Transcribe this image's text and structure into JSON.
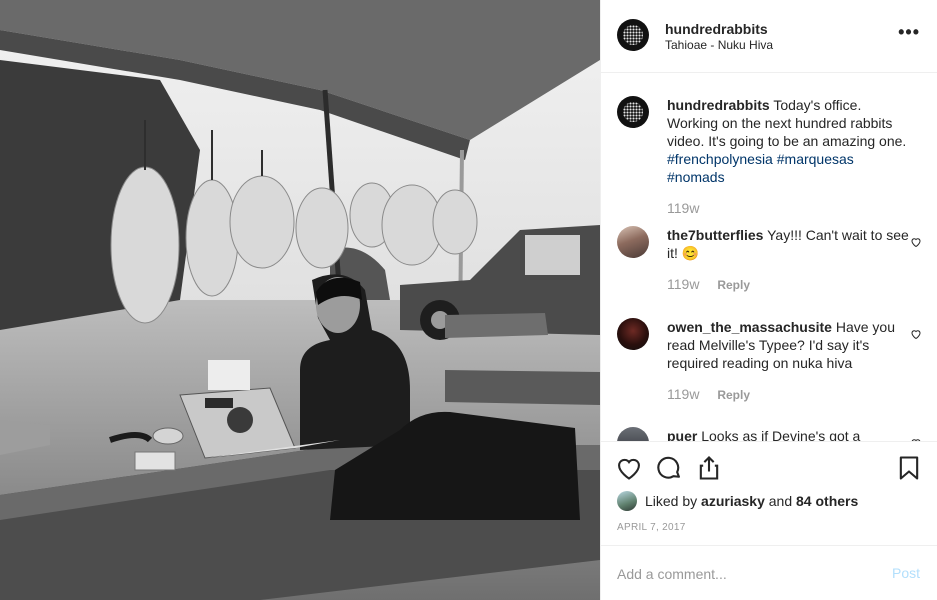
{
  "post": {
    "username": "hundredrabbits",
    "location": "Tahioae - Nuku Hiva",
    "more_icon": "more-horizontal-icon"
  },
  "caption": {
    "username": "hundredrabbits",
    "text": "Today's office. Working on the next hundred rabbits video. It's going to be an amazing one.",
    "tags": [
      "#frenchpolynesia",
      "#marquesas",
      "#nomads"
    ],
    "time": "119w"
  },
  "comments": [
    {
      "username": "the7butterflies",
      "text": "Yay!!! Can't wait to see it! 😊",
      "time": "119w",
      "reply": "Reply"
    },
    {
      "username": "owen_the_massachusite",
      "text": "Have you read Melville's Typee? I'd say it's required reading on nuka hiva",
      "time": "119w",
      "reply": "Reply"
    },
    {
      "username": "puer",
      "text": "Looks as if Devine's got a"
    }
  ],
  "actions": {
    "icons": [
      "heart-icon",
      "comment-icon",
      "share-icon",
      "bookmark-icon"
    ],
    "liked_by_prefix": "Liked by",
    "liked_by_user": "azuriasky",
    "and": "and",
    "others": "84 others",
    "date": "APRIL 7, 2017"
  },
  "add_comment": {
    "placeholder": "Add a comment...",
    "post_label": "Post"
  },
  "colors": {
    "border": "#efefef",
    "hashtag": "#003569",
    "meta_gray": "#999999",
    "post_button": "#b2dffc"
  }
}
